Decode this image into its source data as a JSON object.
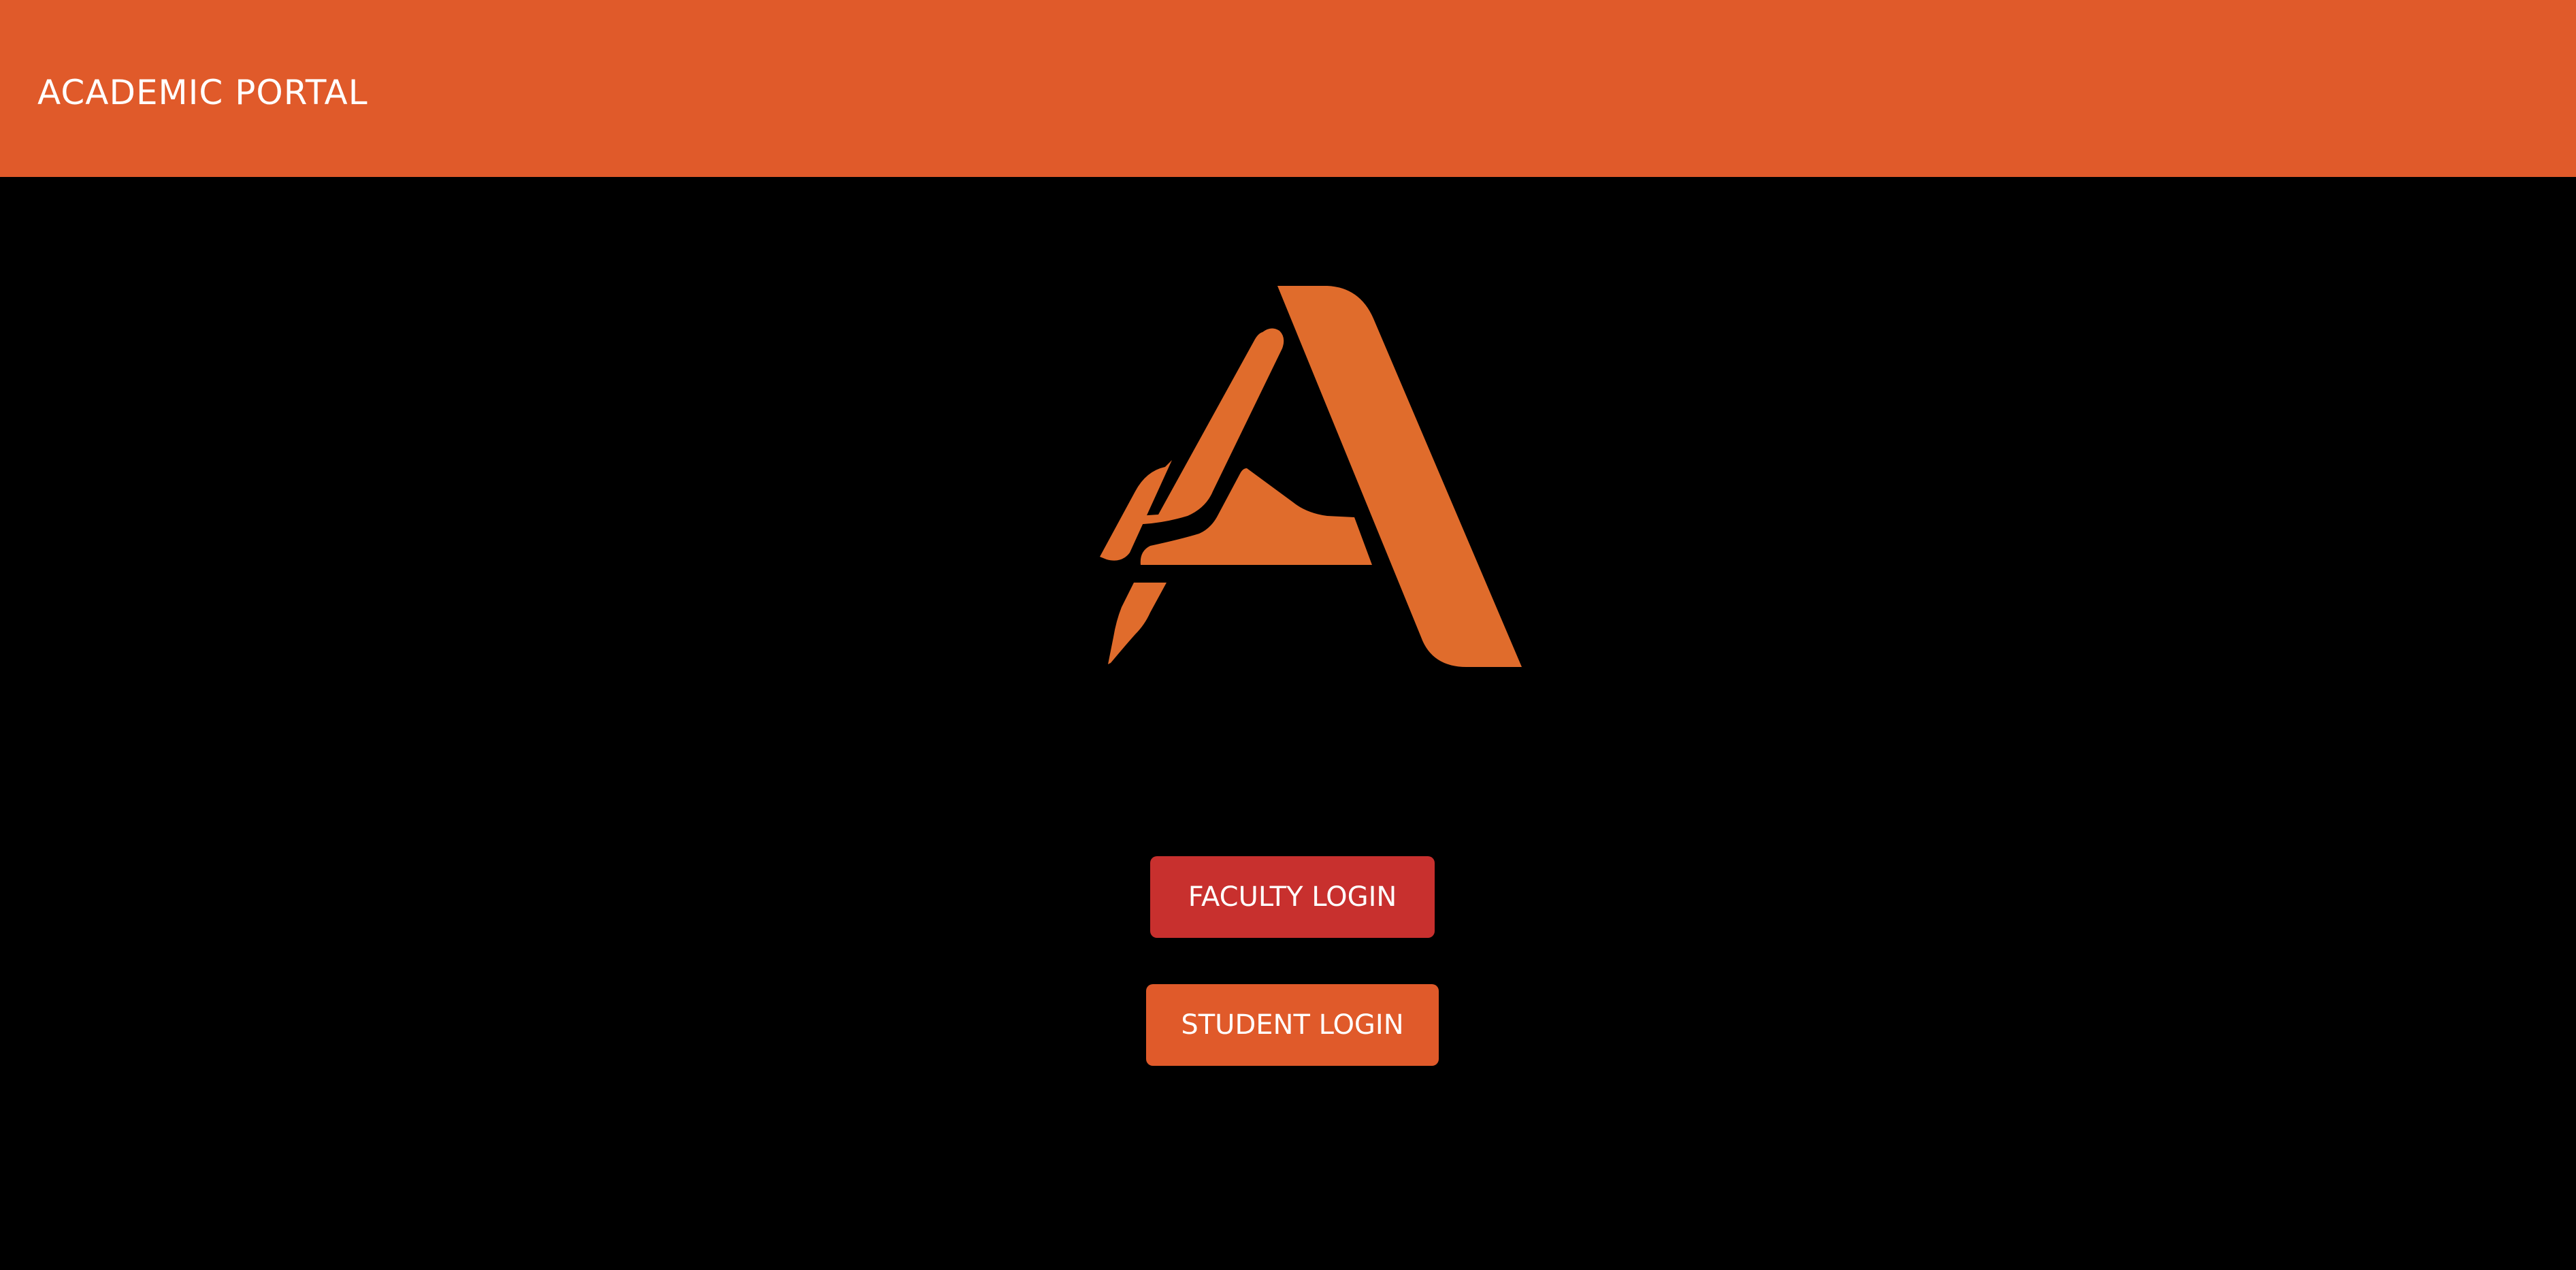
{
  "header": {
    "title": "ACADEMIC PORTAL"
  },
  "logo": {
    "icon": "academic-portal-a-logo",
    "color": "#e06c2c"
  },
  "buttons": {
    "faculty_login": "FACULTY LOGIN",
    "student_login": "STUDENT LOGIN"
  },
  "colors": {
    "header_bg": "#e05a2a",
    "page_bg": "#000000",
    "faculty_button": "#c8302e",
    "student_button": "#e05a2a",
    "button_text": "#ffffff"
  }
}
